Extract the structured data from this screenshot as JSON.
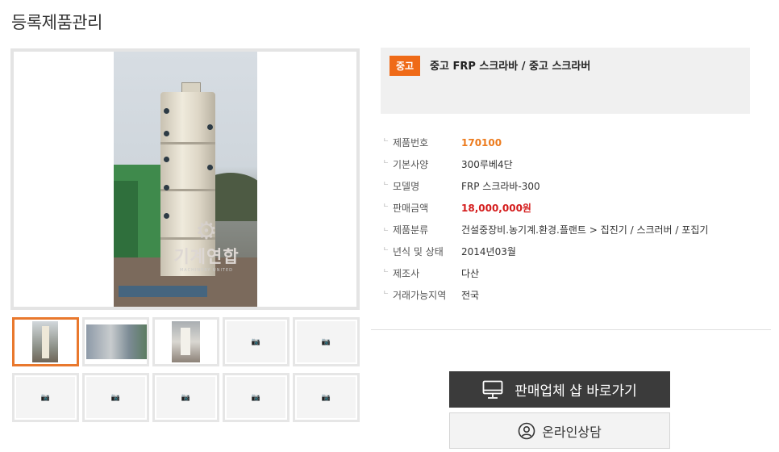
{
  "page": {
    "title": "등록제품관리"
  },
  "main_image": {
    "watermark_text": "기계연합",
    "watermark_sub": "MACHINERY UNITED"
  },
  "thumbnails": {
    "placeholder_label": "사진없음"
  },
  "product": {
    "badge": "중고",
    "title": "중고 FRP 스크라바 / 중고 스크라버"
  },
  "specs": [
    {
      "label": "제품번호",
      "value": "170100",
      "style": "orange"
    },
    {
      "label": "기본사양",
      "value": "300루베4단",
      "style": "normal"
    },
    {
      "label": "모델명",
      "value": "FRP 스크라바-300",
      "style": "normal"
    },
    {
      "label": "판매금액",
      "value": "18,000,000원",
      "style": "red"
    },
    {
      "label": "제품분류",
      "value": "건설중장비.농기계.환경.플랜트 > 집진기 / 스크러버 / 포집기",
      "style": "normal"
    },
    {
      "label": "년식 및 상태",
      "value": "2014년03월",
      "style": "normal"
    },
    {
      "label": "제조사",
      "value": "다산",
      "style": "normal"
    },
    {
      "label": "거래가능지역",
      "value": "전국",
      "style": "normal"
    }
  ],
  "buttons": {
    "shop": "판매업체 샵 바로가기",
    "chat": "온라인상담"
  },
  "colors": {
    "accent_orange": "#ef6a17",
    "price_red": "#d41b1b",
    "dark_button": "#3b3b3b"
  },
  "icons": {
    "shop": "monitor-icon",
    "chat": "headset-icon"
  }
}
